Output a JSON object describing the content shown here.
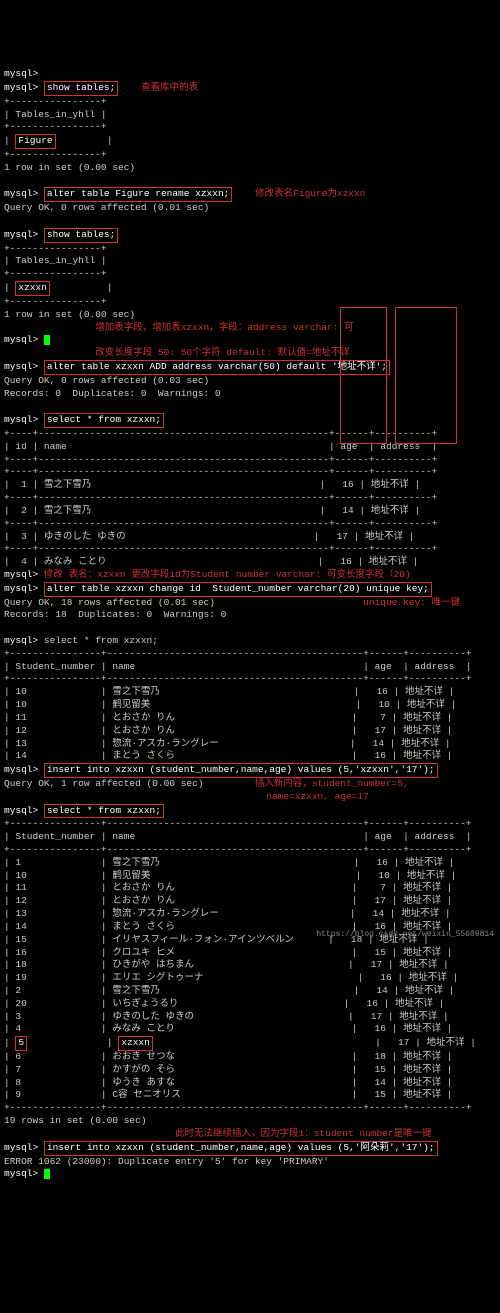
{
  "prompt": "mysql>",
  "cmds": {
    "show_tables": "show tables;",
    "rename": "alter table Figure rename xzxxn;",
    "add_col": "alter table xzxxn ADD address varchar(50) default '地址不详';",
    "select": "select * from xzxxn;",
    "change_id": "alter table xzxxn change id  Student_number varchar(20) unique key;",
    "insert5": "insert into xzxxn (student_number,name,age) values (5,'xzxxn','17');",
    "insert5b": "insert into xzxxn (student_number,name,age) values (5,'阿朵莉','17');"
  },
  "notes": {
    "n1": "查看库中的表",
    "n2": "修改表名Figure为xzxxn",
    "n3": "增加表字段，增加表xzxxn，字段：address varchar: 可",
    "n3b": "改变长度字段 50: 50个字符 default: 默认值=地址不详",
    "n4": "修改 表名：xzxxn 更改字段id为Student number varchar: 可变长度字段（20)",
    "n4b": "unique key: 唯一键",
    "n5": "插入新内容，student_number=5,",
    "n5b": "name=xzxxn, age=17",
    "n6": "此时无法继续插入，因为字段1：student number是唯一键"
  },
  "status": {
    "ok0": "Query OK, 0 rows affected (0.01 sec)",
    "ok0b": "Query OK, 0 rows affected (0.03 sec)",
    "rec0": "Records: 0  Duplicates: 0  Warnings: 0",
    "ok18": "Query OK, 18 rows affected (0.01 sec)",
    "rec18": "Records: 18  Duplicates: 0  Warnings: 0",
    "ok1": "Query OK, 1 row affected (0.00 sec)",
    "row1": "1 row in set (0.00 sec)",
    "rows19": "19 rows in set (0.00 sec)",
    "err": "ERROR 1062 (23000): Duplicate entry '5' for key 'PRIMARY'"
  },
  "hdr": {
    "th1": "Tables_in_yhll",
    "id": "id",
    "name": "name",
    "age": "age",
    "addr": "address",
    "sn": "Student_number"
  },
  "tnames": {
    "figure": "Figure",
    "xzxxn": "xzxxn"
  },
  "rows4": [
    {
      "id": "1",
      "name": "雪之下雪乃",
      "age": "16",
      "addr": "地址不详"
    },
    {
      "id": "2",
      "name": "雪之下雪乃",
      "age": "14",
      "addr": "地址不详"
    },
    {
      "id": "3",
      "name": "ゆきのした ゆきの",
      "age": "17",
      "addr": "地址不详"
    },
    {
      "id": "4",
      "name": "みなみ ことり",
      "age": "16",
      "addr": "地址不详"
    }
  ],
  "rows6": [
    {
      "id": "10",
      "name": "雪之下雪乃",
      "age": "16",
      "addr": "地址不详"
    },
    {
      "id": "10",
      "name": "鹤见留美",
      "age": "10",
      "addr": "地址不详"
    },
    {
      "id": "11",
      "name": "とおさか りん",
      "age": "7",
      "addr": "地址不详"
    },
    {
      "id": "12",
      "name": "とおさか りん",
      "age": "17",
      "addr": "地址不详"
    },
    {
      "id": "13",
      "name": "惣流·アスカ·ラングレー",
      "age": "14",
      "addr": "地址不详"
    },
    {
      "id": "14",
      "name": "まとう さくら",
      "age": "16",
      "addr": "地址不详"
    }
  ],
  "rows19": [
    {
      "id": "1",
      "name": "雪之下雪乃",
      "age": "16",
      "addr": "地址不详"
    },
    {
      "id": "10",
      "name": "鹤见留美",
      "age": "10",
      "addr": "地址不详"
    },
    {
      "id": "11",
      "name": "とおさか りん",
      "age": "7",
      "addr": "地址不详"
    },
    {
      "id": "12",
      "name": "とおさか りん",
      "age": "17",
      "addr": "地址不详"
    },
    {
      "id": "13",
      "name": "惣流·アスカ·ラングレー",
      "age": "14",
      "addr": "地址不详"
    },
    {
      "id": "14",
      "name": "まとう さくら",
      "age": "16",
      "addr": "地址不详"
    },
    {
      "id": "15",
      "name": "イリヤスフィール·フォン·アインツベルン",
      "age": "18",
      "addr": "地址不详"
    },
    {
      "id": "16",
      "name": "クロユキ ヒメ",
      "age": "15",
      "addr": "地址不详"
    },
    {
      "id": "18",
      "name": "ひきがや はちまん",
      "age": "17",
      "addr": "地址不详"
    },
    {
      "id": "19",
      "name": "エリエ シグトゥーナ",
      "age": "16",
      "addr": "地址不详"
    },
    {
      "id": "2",
      "name": "雪之下雪乃",
      "age": "14",
      "addr": "地址不详"
    },
    {
      "id": "20",
      "name": "いちぎょうるり",
      "age": "16",
      "addr": "地址不详"
    },
    {
      "id": "3",
      "name": "ゆきのした ゆきの",
      "age": "17",
      "addr": "地址不详"
    },
    {
      "id": "4",
      "name": "みなみ ことり",
      "age": "16",
      "addr": "地址不详"
    },
    {
      "id": "5",
      "name": "xzxxn",
      "age": "17",
      "addr": "地址不详"
    },
    {
      "id": "6",
      "name": "おおき せつな",
      "age": "18",
      "addr": "地址不详"
    },
    {
      "id": "7",
      "name": "かすがの そら",
      "age": "15",
      "addr": "地址不详"
    },
    {
      "id": "8",
      "name": "ゆうき あすな",
      "age": "14",
      "addr": "地址不详"
    },
    {
      "id": "9",
      "name": "C容 セニオリス",
      "age": "15",
      "addr": "地址不详"
    }
  ],
  "url": "https://blog.csdn.net/weixin_55609814"
}
